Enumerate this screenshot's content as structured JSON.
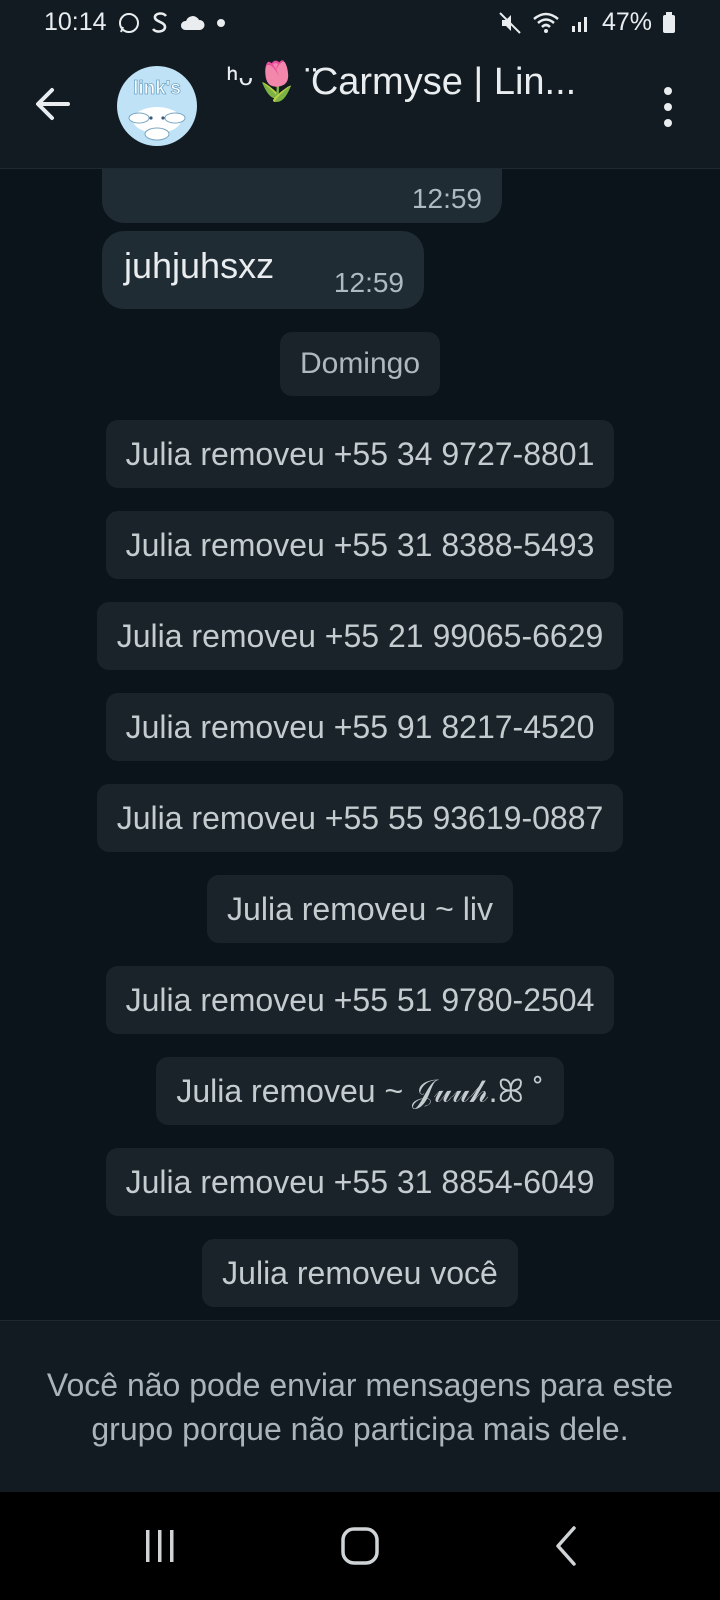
{
  "status": {
    "time": "10:14",
    "battery": "47%"
  },
  "header": {
    "title": "ᑋ︎ᵕ🌷 ̈Carmyse | Lin...",
    "avatar_text": "link's"
  },
  "messages": [
    {
      "text": "",
      "time": "12:59"
    },
    {
      "text": "juhjuhsxz",
      "time": "12:59"
    }
  ],
  "date_divider": "Domingo",
  "system_messages": [
    "Julia removeu +55 34 9727-8801",
    "Julia removeu +55 31 8388-5493",
    "Julia removeu +55 21 99065-6629",
    "Julia removeu +55 91 8217-4520",
    "Julia removeu +55 55 93619-0887",
    "Julia removeu ~ liv",
    "Julia removeu +55 51 9780-2504",
    "Julia removeu ~ 𝒥𝓊𝓊𝒽.ꕤ ˚",
    "Julia removeu +55 31 8854-6049",
    "Julia removeu você"
  ],
  "footer": {
    "text": "Você não pode enviar mensagens para este grupo porque não participa mais dele."
  },
  "icons": {
    "back": "arrow-left-icon",
    "menu": "kebab-menu-icon",
    "nav_recent": "recent-apps-icon",
    "nav_home": "home-icon",
    "nav_back": "nav-back-icon"
  },
  "colors": {
    "background": "#0b141a",
    "bar": "#111b21",
    "bubble": "#1f2c34",
    "system_pill": "#1a2329"
  }
}
